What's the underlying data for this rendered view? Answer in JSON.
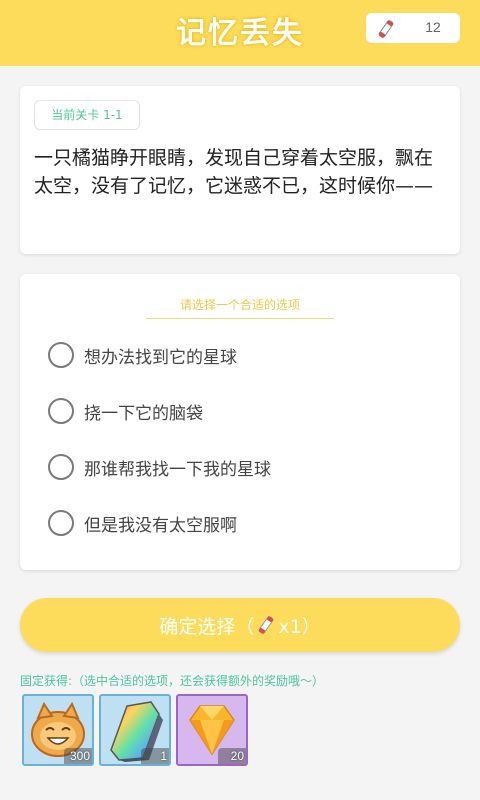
{
  "header": {
    "title": "记忆丢失",
    "ticket_icon": "ticket-icon",
    "ticket_count": "12",
    "background_color": "#fcdc5a"
  },
  "story": {
    "level_badge": "当前关卡 1-1",
    "text": "一只橘猫睁开眼睛，发现自己穿着太空服，飘在太空，没有了记忆，它迷惑不已，这时候你——"
  },
  "options": {
    "prompt": "请选择一个合适的选项",
    "items": [
      {
        "label": "想办法找到它的星球",
        "selected": false
      },
      {
        "label": "挠一下它的脑袋",
        "selected": false
      },
      {
        "label": "那谁帮我找一下我的星球",
        "selected": false
      },
      {
        "label": "但是我没有太空服啊",
        "selected": false
      }
    ]
  },
  "confirm": {
    "label": "确定选择（",
    "cost": "x1）",
    "icon": "ticket-icon"
  },
  "rewards": {
    "note": "固定获得:（选中合适的选项，还会获得额外的奖励哦～）",
    "items": [
      {
        "icon": "cat-coin-icon",
        "quantity": "300"
      },
      {
        "icon": "crystal-icon",
        "quantity": "1"
      },
      {
        "icon": "diamond-icon",
        "quantity": "20"
      }
    ]
  }
}
